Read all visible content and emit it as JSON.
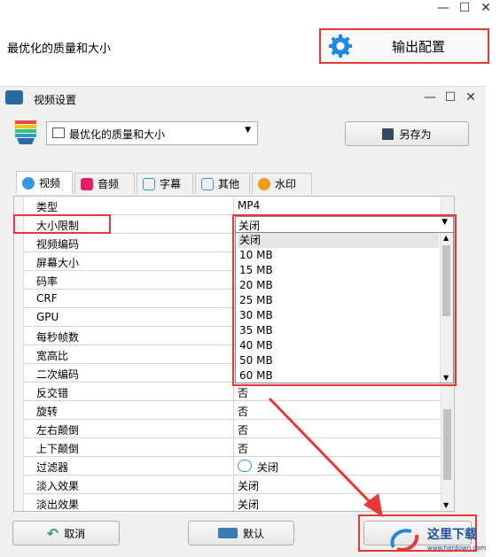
{
  "main": {
    "profile_label": "最优化的质量和大小",
    "output_config_label": "输出配置"
  },
  "dialog": {
    "title": "视频设置",
    "preset_value": "最优化的质量和大小",
    "save_as_label": "另存为",
    "tabs": [
      "视频",
      "音频",
      "字幕",
      "其他",
      "水印"
    ],
    "rows": [
      {
        "key": "类型",
        "value": "MP4"
      },
      {
        "key": "大小限制",
        "value": "关闭"
      },
      {
        "key": "视频编码",
        "value": ""
      },
      {
        "key": "屏幕大小",
        "value": ""
      },
      {
        "key": "码率",
        "value": ""
      },
      {
        "key": "CRF",
        "value": ""
      },
      {
        "key": "GPU",
        "value": ""
      },
      {
        "key": "每秒帧数",
        "value": ""
      },
      {
        "key": "宽高比",
        "value": ""
      },
      {
        "key": "二次编码",
        "value": ""
      },
      {
        "key": "反交错",
        "value": "否"
      },
      {
        "key": "旋转",
        "value": "否"
      },
      {
        "key": "左右颠倒",
        "value": "否"
      },
      {
        "key": "上下颠倒",
        "value": "否"
      },
      {
        "key": "过滤器",
        "value": "关闭"
      },
      {
        "key": "淡入效果",
        "value": "关闭"
      },
      {
        "key": "淡出效果",
        "value": "关闭"
      }
    ],
    "size_options": [
      "关闭",
      "10 MB",
      "15 MB",
      "20 MB",
      "25 MB",
      "30 MB",
      "35 MB",
      "40 MB",
      "50 MB",
      "60 MB"
    ],
    "cancel_label": "取消",
    "default_label": "默认"
  },
  "watermark": {
    "site_name": "这里下载",
    "site_url": "www.herdown.com"
  },
  "colors": {
    "highlight_red": "#e53935",
    "accent_blue": "#1e88e5"
  }
}
